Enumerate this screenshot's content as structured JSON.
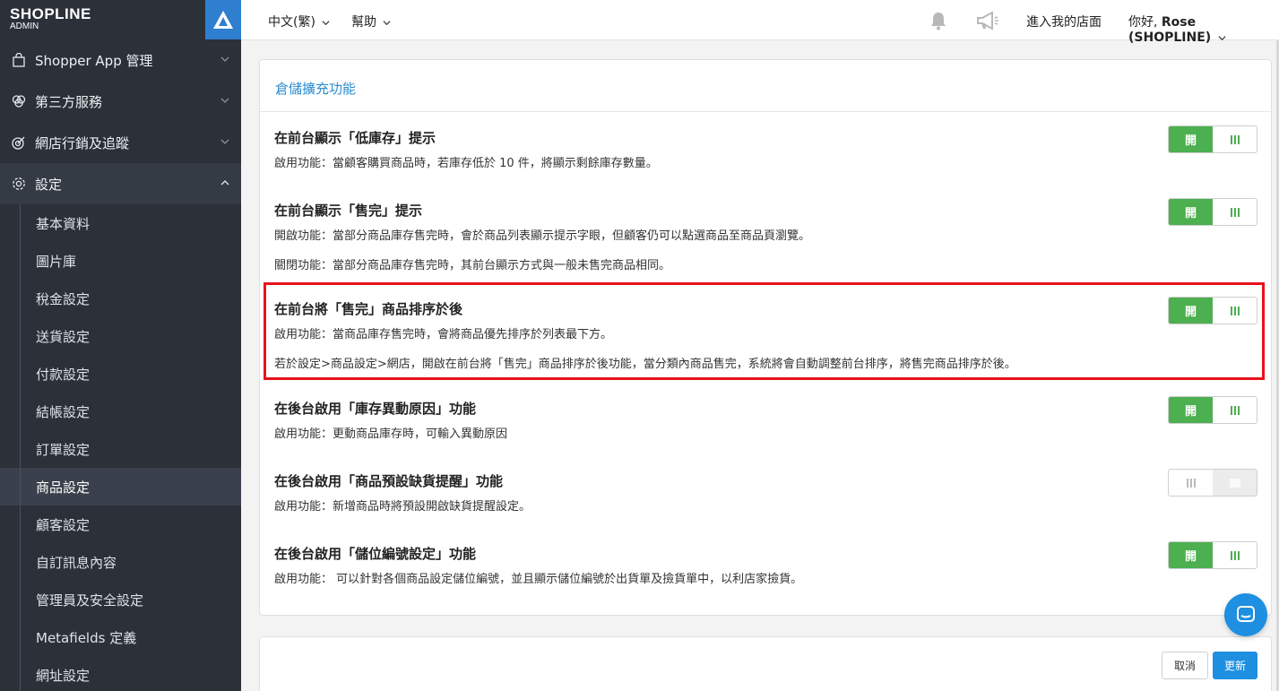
{
  "brand": {
    "logo": "SHOPLINE",
    "sub": "ADMIN"
  },
  "sidebar": {
    "items": [
      {
        "label": "Shopper App 管理",
        "icon": "shopping-bag-icon"
      },
      {
        "label": "第三方服務",
        "icon": "integration-icon"
      },
      {
        "label": "網店行銷及追蹤",
        "icon": "target-icon"
      },
      {
        "label": "設定",
        "icon": "gear-icon"
      }
    ],
    "sub_items": [
      "基本資料",
      "圖片庫",
      "稅金設定",
      "送貨設定",
      "付款設定",
      "結帳設定",
      "訂單設定",
      "商品設定",
      "顧客設定",
      "自訂訊息內容",
      "管理員及安全設定",
      "Metafields 定義",
      "網址設定"
    ],
    "active_sub": "商品設定"
  },
  "topbar": {
    "language": "中文(繁)",
    "help": "幫助",
    "store_link": "進入我的店面",
    "greeting": "你好,",
    "user": "Rose (SHOPLINE)"
  },
  "card": {
    "title": "倉儲擴充功能",
    "settings": [
      {
        "title": "在前台顯示「低庫存」提示",
        "lines": [
          "啟用功能：當顧客購買商品時，若庫存低於 10 件，將顯示剩餘庫存數量。"
        ],
        "enabled": true,
        "on_label": "開"
      },
      {
        "title": "在前台顯示「售完」提示",
        "lines": [
          "開啟功能：當部分商品庫存售完時，會於商品列表顯示提示字眼，但顧客仍可以點選商品至商品頁瀏覽。",
          "關閉功能：當部分商品庫存售完時，其前台顯示方式與一般未售完商品相同。"
        ],
        "enabled": true,
        "on_label": "開"
      },
      {
        "title": "在前台將「售完」商品排序於後",
        "lines": [
          "啟用功能：當商品庫存售完時，會將商品優先排序於列表最下方。",
          "若於設定>商品設定>網店，開啟在前台將「售完」商品排序於後功能，當分類內商品售完，系統將會自動調整前台排序，將售完商品排序於後。"
        ],
        "enabled": true,
        "on_label": "開"
      },
      {
        "title": "在後台啟用「庫存異動原因」功能",
        "lines": [
          "啟用功能：更動商品庫存時，可輸入異動原因"
        ],
        "enabled": true,
        "on_label": "開"
      },
      {
        "title": "在後台啟用「商品預設缺貨提醒」功能",
        "lines": [
          "啟用功能：新增商品時將預設開啟缺貨提醒設定。"
        ],
        "enabled": false,
        "on_label": ""
      },
      {
        "title": "在後台啟用「儲位編號設定」功能",
        "lines": [
          "啟用功能： 可以針對各個商品設定儲位編號，並且顯示儲位編號於出貨單及撿貨單中，以利店家撿貨。"
        ],
        "enabled": true,
        "on_label": "開"
      }
    ]
  },
  "footer": {
    "cancel": "取消",
    "update": "更新"
  },
  "colors": {
    "sidebar_bg": "#2b3039",
    "accent_blue": "#1e8fe1",
    "toggle_green": "#4caf50",
    "highlight_red": "#e8121b"
  }
}
